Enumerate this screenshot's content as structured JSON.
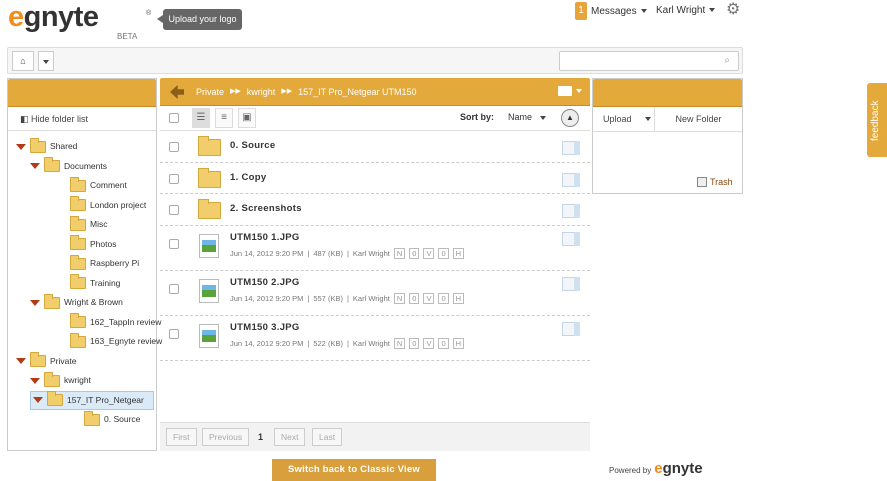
{
  "header": {
    "logo_text": "egnyte",
    "logo_badge": "BETA",
    "upload_logo_label": "Upload your logo",
    "messages_count": "1",
    "messages_label": "Messages",
    "user_name": "Karl Wright"
  },
  "nav": {
    "search_placeholder": ""
  },
  "sidebar": {
    "hide_label": "Hide folder list",
    "tree": [
      {
        "label": "Shared",
        "expanded": true,
        "level": 0
      },
      {
        "label": "Documents",
        "expanded": true,
        "level": 1
      },
      {
        "label": "Comment",
        "level": 2
      },
      {
        "label": "London project",
        "level": 2
      },
      {
        "label": "Misc",
        "level": 2
      },
      {
        "label": "Photos",
        "level": 2
      },
      {
        "label": "Raspberry Pi",
        "level": 2
      },
      {
        "label": "Training",
        "level": 2
      },
      {
        "label": "Wright & Brown",
        "expanded": true,
        "level": 1
      },
      {
        "label": "162_TappIn review",
        "level": 2
      },
      {
        "label": "163_Egnyte review",
        "level": 2
      },
      {
        "label": "Private",
        "expanded": true,
        "level": 0
      },
      {
        "label": "kwright",
        "expanded": true,
        "level": 1
      },
      {
        "label": "157_IT Pro_Netgear",
        "expanded": true,
        "level": 1,
        "selected": true
      },
      {
        "label": "0. Source",
        "level": 3
      }
    ]
  },
  "breadcrumb": [
    "Private",
    "kwright",
    "157_IT Pro_Netgear UTM150"
  ],
  "toolbar": {
    "sort_label": "Sort by:",
    "sort_value": "Name"
  },
  "files": [
    {
      "name": "0. Source",
      "type": "folder"
    },
    {
      "name": "1. Copy",
      "type": "folder"
    },
    {
      "name": "2. Screenshots",
      "type": "folder"
    },
    {
      "name": "UTM150 1.JPG",
      "type": "image",
      "date": "Jun 14, 2012 9:20 PM",
      "size": "487 (KB)",
      "owner": "Karl Wright",
      "n": "N",
      "n_count": "0",
      "v": "V",
      "v_count": "0",
      "h": "H"
    },
    {
      "name": "UTM150 2.JPG",
      "type": "image",
      "date": "Jun 14, 2012 9:20 PM",
      "size": "557 (KB)",
      "owner": "Karl Wright",
      "n": "N",
      "n_count": "0",
      "v": "V",
      "v_count": "0",
      "h": "H"
    },
    {
      "name": "UTM150 3.JPG",
      "type": "image",
      "date": "Jun 14, 2012 9:20 PM",
      "size": "522 (KB)",
      "owner": "Karl Wright",
      "n": "N",
      "n_count": "0",
      "v": "V",
      "v_count": "0",
      "h": "H"
    }
  ],
  "pager": {
    "first": "First",
    "previous": "Previous",
    "page": "1",
    "next": "Next",
    "last": "Last"
  },
  "right": {
    "upload_label": "Upload",
    "new_folder_label": "New Folder",
    "trash_label": "Trash"
  },
  "footer": {
    "classic_label": "Switch back to Classic View",
    "powered_label": "Powered by",
    "powered_brand": "egnyte"
  },
  "feedback_label": "feedback",
  "colors": {
    "accent": "#e3a93b",
    "brand_orange": "#f28c1c",
    "folder": "#f2cd6b"
  }
}
